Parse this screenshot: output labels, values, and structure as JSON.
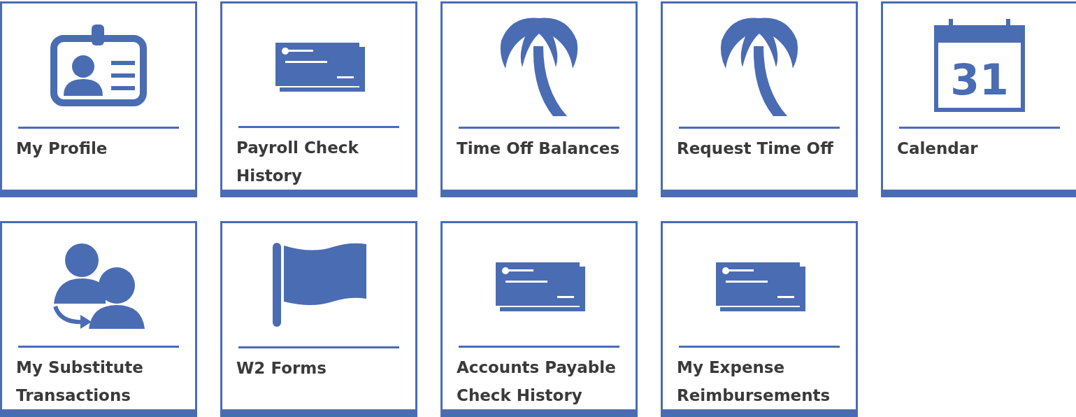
{
  "tiles": [
    {
      "label": "My Profile",
      "kind": "badge"
    },
    {
      "label": "Payroll Check History",
      "kind": "check"
    },
    {
      "label": "Time Off Balances",
      "kind": "palm"
    },
    {
      "label": "Request Time Off",
      "kind": "palm"
    },
    {
      "label": "Calendar",
      "kind": "calendar",
      "icon_text": "31"
    },
    {
      "label": "My Substitute Transactions",
      "kind": "people"
    },
    {
      "label": "W2 Forms",
      "kind": "flag"
    },
    {
      "label": "Accounts Payable Check History",
      "kind": "check"
    },
    {
      "label": "My Expense Reimbursements",
      "kind": "check"
    }
  ]
}
